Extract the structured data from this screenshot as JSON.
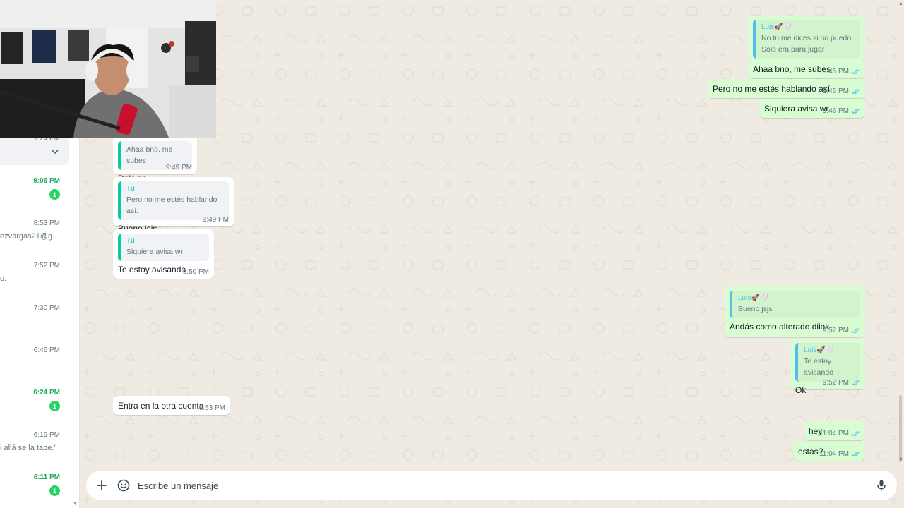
{
  "sidebar": {
    "top_card_time": "9:24 PM",
    "items": [
      {
        "time": "9:06 PM",
        "unread": true,
        "badge": "1",
        "snippet": ""
      },
      {
        "time": "8:53 PM",
        "unread": false,
        "badge": "",
        "snippet": "ezvargas21@g..."
      },
      {
        "time": "7:52 PM",
        "unread": false,
        "badge": "",
        "snippet": "o."
      },
      {
        "time": "7:30 PM",
        "unread": false,
        "badge": "",
        "snippet": ""
      },
      {
        "time": "6:46 PM",
        "unread": false,
        "badge": "",
        "snippet": ""
      },
      {
        "time": "6:24 PM",
        "unread": true,
        "badge": "1",
        "snippet": ""
      },
      {
        "time": "6:19 PM",
        "unread": false,
        "badge": "",
        "snippet": "i allá se la tape.\""
      },
      {
        "time": "6:11 PM",
        "unread": true,
        "badge": "1",
        "snippet": ""
      }
    ]
  },
  "messages": {
    "m1": {
      "quote_name": "Luis🚀🤍",
      "quote_text_1": "No tu me dices si no puedo",
      "quote_text_2": "Solo era para jugar"
    },
    "m2": {
      "text": "Ahaa bno, me subes",
      "time": "9:45 PM"
    },
    "m3": {
      "text": "Pero no me estés hablando así.",
      "time": "9:45 PM"
    },
    "m4": {
      "text": "Siquiera avisa wr",
      "time": "9:46 PM"
    },
    "m5": {
      "quote_text": "Ahaa bno, me subes",
      "text": "Dale ps",
      "time": "9:49 PM"
    },
    "m6": {
      "quote_name": "Tú",
      "quote_text": "Pero no me estés hablando así.",
      "text": "Bueno jsjs",
      "time": "9:49 PM"
    },
    "m7": {
      "quote_name": "Tú",
      "quote_text": "Siquiera avisa wr",
      "text": "Te estoy avisando",
      "time": "9:50 PM"
    },
    "m8": {
      "quote_name": "Luis🚀🤍",
      "quote_text": "Bueno jsjs",
      "text": "Andás como alterado diiak",
      "time": "9:52 PM"
    },
    "m9": {
      "quote_name": "Luis🚀🤍",
      "quote_text": "Te estoy avisando",
      "text": "Ok",
      "time": "9:52 PM"
    },
    "m10": {
      "text": "Entra en la otra cuenta",
      "time": "9:53 PM"
    },
    "m11": {
      "text": "hey",
      "time": "11:04 PM"
    },
    "m12": {
      "text": "estas?",
      "time": "11:04 PM"
    }
  },
  "composer": {
    "placeholder": "Escribe un mensaje",
    "plus_icon": "plus-icon",
    "sticker_icon": "sticker-icon",
    "mic_icon": "microphone-icon"
  },
  "colors": {
    "chat_bg": "#efeae2",
    "outgoing": "#d9fdd3",
    "incoming": "#ffffff",
    "read_ticks": "#53bdeb",
    "unread_green": "#25d366"
  }
}
